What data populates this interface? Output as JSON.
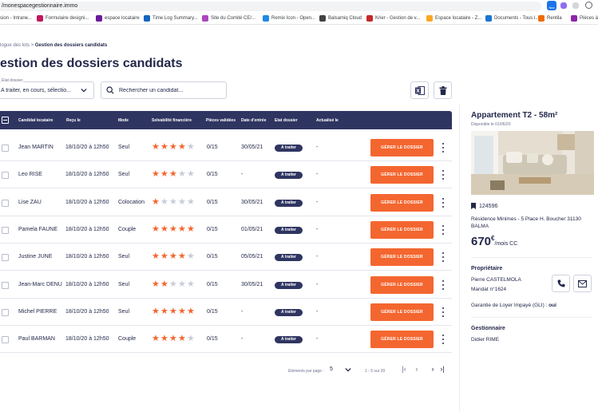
{
  "browser": {
    "url": "/monespacegestionnaire.immo",
    "bookmarks": [
      {
        "label": "sion - Intrane...",
        "color": "#9aa0a6"
      },
      {
        "label": "Formulaire designi...",
        "color": "#c2185b"
      },
      {
        "label": "espace locataire",
        "color": "#6a1b9a"
      },
      {
        "label": "Time Log Summary...",
        "color": "#1565c0"
      },
      {
        "label": "Site du Comité CE/...",
        "color": "#ab47bc"
      },
      {
        "label": "Remix Icon - Open...",
        "color": "#1e88e5"
      },
      {
        "label": "Balsamiq Cloud",
        "color": "#424242"
      },
      {
        "label": "Krier - Gestion de v...",
        "color": "#c62828"
      },
      {
        "label": "Espace locataire - Z...",
        "color": "#f9a825"
      },
      {
        "label": "Documents - Tous l...",
        "color": "#1976d2"
      },
      {
        "label": "Rentila",
        "color": "#ef6c00"
      },
      {
        "label": "Pièces à",
        "color": "#8e24aa"
      }
    ],
    "ext_badge": "New"
  },
  "breadcrumb": {
    "parent": "logue des lots",
    "separator": ">",
    "current": "Gestion des dossiers candidats"
  },
  "page": {
    "title": "estion des dossiers candidats"
  },
  "filters": {
    "status_label": "Etat dossier",
    "status_value": "A traiter, en cours, sélectio...",
    "search_placeholder": "Rechercher un candidat..."
  },
  "table": {
    "headers": {
      "candidat": "Candidat locataire",
      "recu": "Reçu le",
      "mode": "Mode",
      "solva": "Solvabilité financière",
      "pieces": "Pièces validées",
      "entree": "Date d'entrée",
      "etat": "Etat dossier",
      "actualise": "Actualisé le"
    },
    "action_label": "GÉRER LE DOSSIER",
    "rows": [
      {
        "name": "Jean MARTIN",
        "recu": "18/10/20 à 12h50",
        "mode": "Seul",
        "stars": 4,
        "pieces": "0/15",
        "entree": "30/05/21",
        "etat": "A traiter",
        "actualise": "-"
      },
      {
        "name": "Leo RISE",
        "recu": "18/10/20 à 12h50",
        "mode": "Seul",
        "stars": 3,
        "pieces": "0/15",
        "entree": "-",
        "etat": "A traiter",
        "actualise": "-"
      },
      {
        "name": "Lise ZAU",
        "recu": "18/10/20 à 12h50",
        "mode": "Colocation",
        "stars": 1,
        "pieces": "0/15",
        "entree": "30/05/21",
        "etat": "A traiter",
        "actualise": "-"
      },
      {
        "name": "Pamela FAUNE",
        "recu": "18/10/20 à 12h50",
        "mode": "Couple",
        "stars": 5,
        "pieces": "0/15",
        "entree": "01/05/21",
        "etat": "A traiter",
        "actualise": "-"
      },
      {
        "name": "Justine JUNE",
        "recu": "18/10/20 à 12h50",
        "mode": "Seul",
        "stars": 4,
        "pieces": "0/15",
        "entree": "05/05/21",
        "etat": "A traiter",
        "actualise": "-"
      },
      {
        "name": "Jean-Marc DENU",
        "recu": "18/10/20 à 12h50",
        "mode": "Seul",
        "stars": 2,
        "pieces": "0/15",
        "entree": "30/05/21",
        "etat": "A traiter",
        "actualise": "-"
      },
      {
        "name": "Michel PIERRE",
        "recu": "18/10/20 à 12h50",
        "mode": "Seul",
        "stars": 5,
        "pieces": "0/15",
        "entree": "-",
        "etat": "A traiter",
        "actualise": "-"
      },
      {
        "name": "Paul BARMAN",
        "recu": "18/10/20 à 12h50",
        "mode": "Couple",
        "stars": 4,
        "pieces": "0/15",
        "entree": "-",
        "etat": "A traiter",
        "actualise": "-"
      }
    ]
  },
  "pagination": {
    "per_page_label": "Eléments par page :",
    "per_page_value": "5",
    "range": "1 - 5 sur 20"
  },
  "property": {
    "title": "Appartement T2 - 58m²",
    "available": "Disponible le 01/06/20",
    "reference": "124596",
    "address": "Résidence Minimes - 5 Place H. Boucher 31130 BALMA",
    "price": "670",
    "price_currency": "€",
    "price_unit": "/mois CC",
    "owner_title": "Propriétaire",
    "owner_name": "Pierre CASTELMOLA",
    "owner_mandate": "Mandat n°1624",
    "gli_label": "Garantie de Loyer Impayé (GLI) :",
    "gli_value": "oui",
    "manager_title": "Gestionnaire",
    "manager_name": "Didier RIME"
  },
  "colors": {
    "navy": "#2f3561",
    "accent": "#f4662f",
    "star_on": "#f4662f",
    "star_off": "#c9ccd9"
  }
}
